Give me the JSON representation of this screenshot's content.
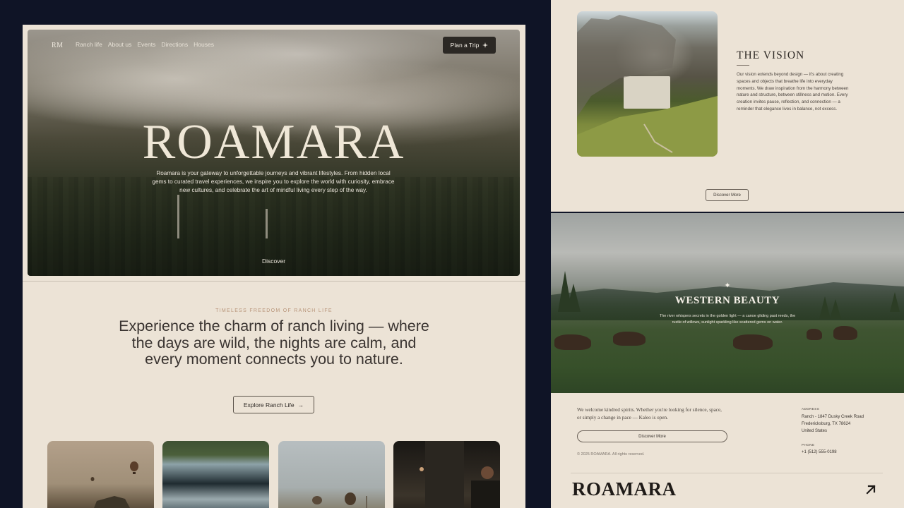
{
  "left_page": {
    "nav": {
      "logo": "RM",
      "links": [
        "Ranch life",
        "About us",
        "Events",
        "Directions",
        "Houses"
      ],
      "cta_label": "Plan a Trip",
      "cta_icon": "sparkle-icon"
    },
    "hero": {
      "title": "ROAMARA",
      "description": "Roamara is your gateway to unforgettable journeys and vibrant lifestyles. From hidden local gems to curated travel experiences, we inspire you to explore the world with curiosity, embrace new cultures, and celebrate the art of mindful living every step of the way.",
      "discover_label": "Discover"
    },
    "intro": {
      "kicker": "TIMELESS FREEDOM OF RANCH LIFE",
      "statement": "Experience the charm of ranch living — where the days are wild, the nights are calm, and every moment connects you to nature.",
      "button_label": "Explore Ranch Life",
      "button_icon": "→"
    }
  },
  "vision": {
    "title": "THE VISION",
    "text": "Our vision extends beyond design — it's about creating spaces and objects that breathe life into everyday moments. We draw inspiration from the harmony between nature and structure, between stillness and motion. Every creation invites pause, reflection, and connection — a reminder that elegance lives in balance, not excess.",
    "button_label": "Discover More"
  },
  "western": {
    "star": "✦",
    "title": "WESTERN BEAUTY",
    "description": "The river whispers secrets in the golden light — a canoe gliding past reeds, the rustle of willows, sunlight sparkling like scattered gems on water."
  },
  "footer": {
    "welcome": "We welcome kindred spirits. Whether you're looking for silence, space, or simply a change in pace — Kaleo is open.",
    "button_label": "Discover More",
    "copyright": "© 2025 ROAMARA. All rights reserved.",
    "address_label": "ADDRESS",
    "address_lines": [
      "Ranch - 1847 Dusky Creek Road",
      "Fredericksburg, TX 78624",
      "United States"
    ],
    "phone_label": "PHONE",
    "phone": "+1 (512) 555-0198",
    "brand": "ROAMARA",
    "arrow_icon": "arrow-up-right-icon"
  }
}
